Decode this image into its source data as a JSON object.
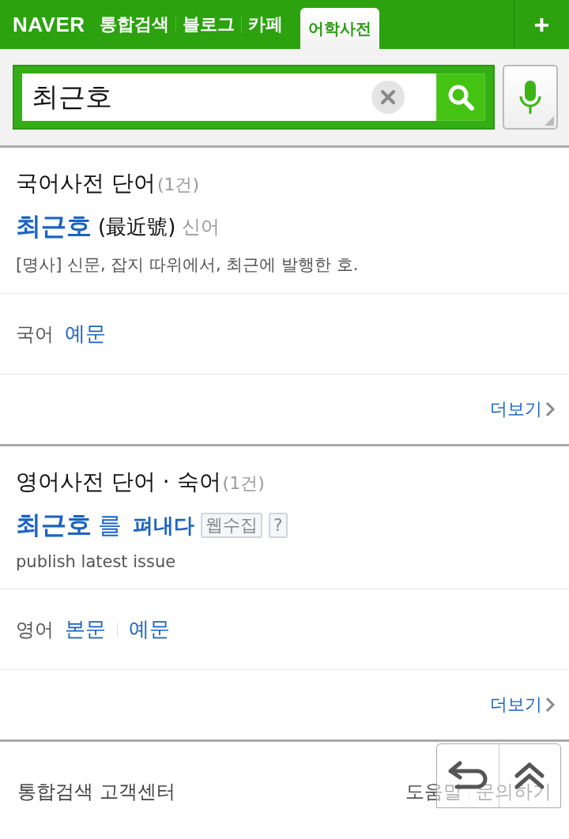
{
  "top_bar": {
    "logo": "NAVER",
    "tabs": [
      {
        "label": "통합검색",
        "selected": false
      },
      {
        "label": "블로그",
        "selected": false
      },
      {
        "label": "카페",
        "selected": false
      },
      {
        "label": "어학사전",
        "selected": true
      }
    ],
    "add_button": "+"
  },
  "search": {
    "value": "최근호"
  },
  "sections": [
    {
      "title": "국어사전 단어",
      "count": "(1건)",
      "segments": [
        {
          "kind": "headword",
          "text": "최근호"
        },
        {
          "kind": "hanja",
          "text": "(最近號)"
        },
        {
          "kind": "tag",
          "text": "신어"
        }
      ],
      "definition": "[명사] 신문, 잡지 따위에서, 최근에 발행한 호.",
      "links_label": "국어",
      "links": [
        "예문"
      ],
      "more": "더보기"
    },
    {
      "title": "영어사전 단어 · 숙어",
      "count": "(1건)",
      "segments": [
        {
          "kind": "headword",
          "text": "최근호"
        },
        {
          "kind": "particle",
          "text": "를"
        },
        {
          "kind": "phrase",
          "text": "펴내다"
        },
        {
          "kind": "badge",
          "text": "웹수집"
        },
        {
          "kind": "badge",
          "text": "?"
        }
      ],
      "definition": "publish latest issue",
      "links_label": "영어",
      "links": [
        "본문",
        "예문"
      ],
      "more": "더보기"
    }
  ],
  "footer": {
    "title": "통합검색 고객센터",
    "links": [
      "도움말",
      "문의하기"
    ]
  }
}
